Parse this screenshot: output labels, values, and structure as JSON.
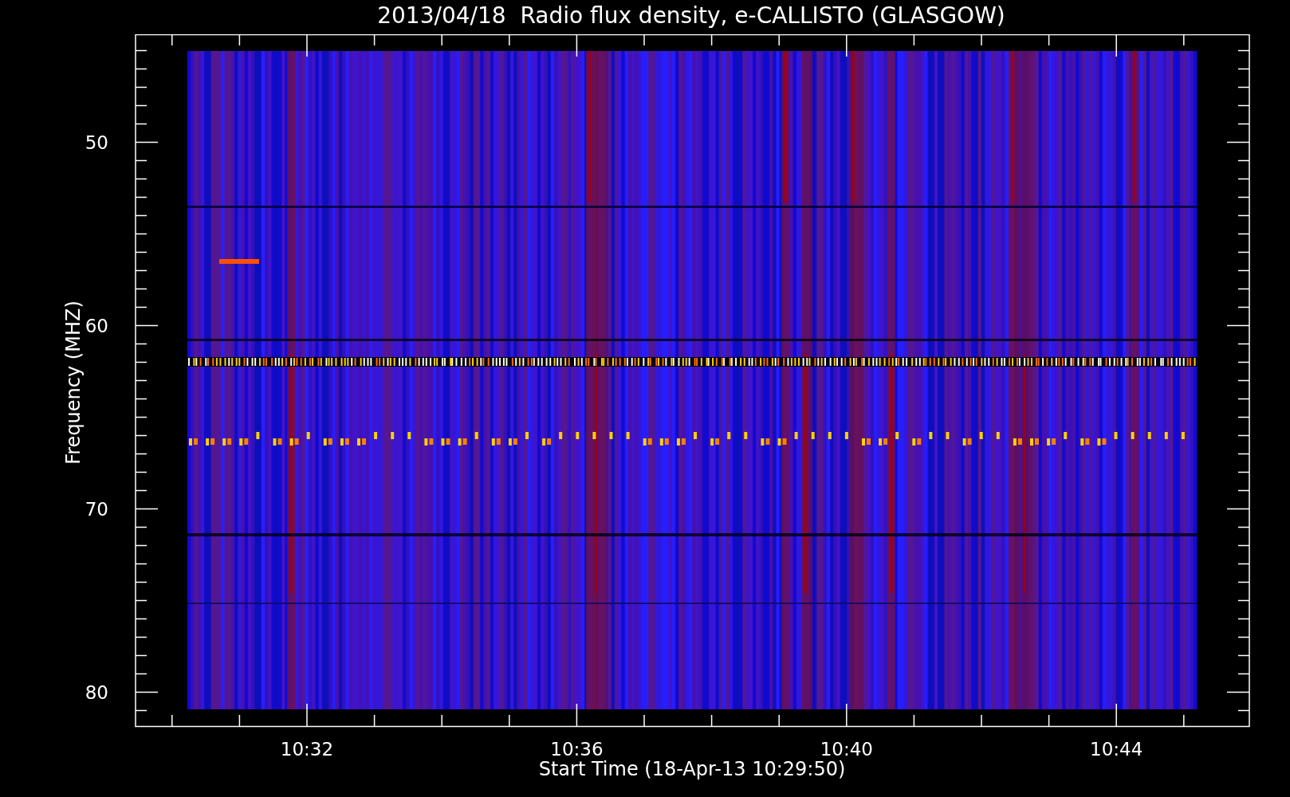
{
  "title": "2013/04/18  Radio flux density, e-CALLISTO (GLASGOW)",
  "y_axis": {
    "label": "Frequency (MHZ)",
    "ticks": [
      "50",
      "60",
      "70",
      "80"
    ]
  },
  "x_axis": {
    "label": "Start Time (18-Apr-13 10:29:50)",
    "ticks": [
      "10:32",
      "10:36",
      "10:40",
      "10:44"
    ]
  }
}
